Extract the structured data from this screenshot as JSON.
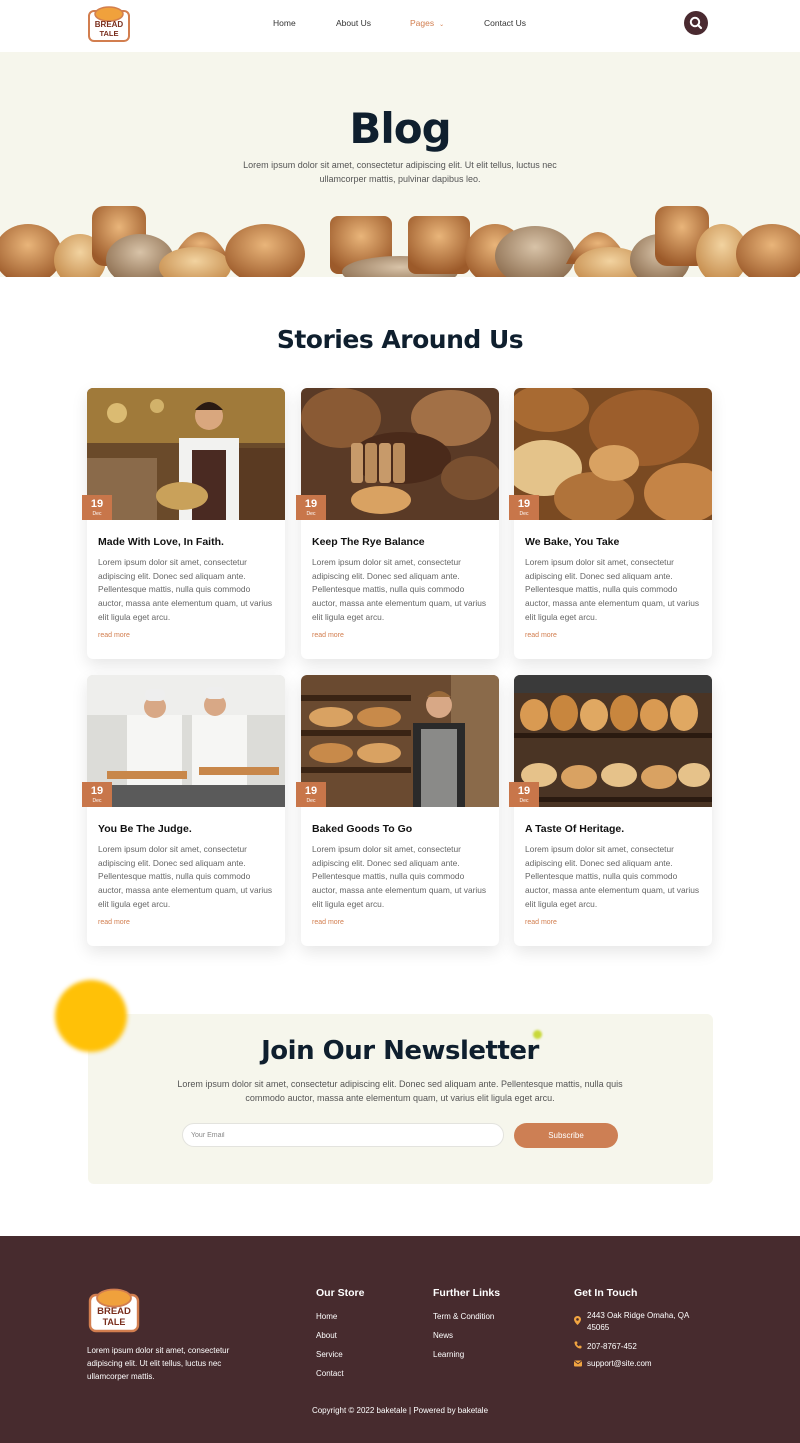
{
  "brand": {
    "logo_line1": "BREAD",
    "logo_line2": "TALE"
  },
  "nav": {
    "items": [
      "Home",
      "About Us",
      "Pages",
      "Contact Us"
    ],
    "pages_caret": "⌄",
    "active_color": "#d27e4f"
  },
  "hero": {
    "title": "Blog",
    "subtitle": "Lorem ipsum dolor sit amet, consectetur adipiscing elit. Ut elit tellus, luctus nec ullamcorper mattis, pulvinar dapibus leo."
  },
  "stories": {
    "title": "Stories Around Us",
    "posts": [
      {
        "title": "Made With Love, In Faith.",
        "day": "19",
        "month": "Dec",
        "text": "Lorem ipsum dolor sit amet, consectetur adipiscing elit. Donec sed aliquam ante. Pellentesque mattis, nulla quis commodo auctor, massa ante elementum quam, ut varius elit ligula eget arcu.",
        "link": "read more",
        "image": "baker-with-bread-basket"
      },
      {
        "title": "Keep The Rye Balance",
        "day": "19",
        "month": "Dec",
        "text": "Lorem ipsum dolor sit amet, consectetur adipiscing elit. Donec sed aliquam ante. Pellentesque mattis, nulla quis commodo auctor, massa ante elementum quam, ut varius elit ligula eget arcu.",
        "link": "read more",
        "image": "sliced-rye-bread"
      },
      {
        "title": "We Bake, You Take",
        "day": "19",
        "month": "Dec",
        "text": "Lorem ipsum dolor sit amet, consectetur adipiscing elit. Donec sed aliquam ante. Pellentesque mattis, nulla quis commodo auctor, massa ante elementum quam, ut varius elit ligula eget arcu.",
        "link": "read more",
        "image": "assorted-bread-loaves"
      },
      {
        "title": "You Be The Judge.",
        "day": "19",
        "month": "Dec",
        "text": "Lorem ipsum dolor sit amet, consectetur adipiscing elit. Donec sed aliquam ante. Pellentesque mattis, nulla quis commodo auctor, massa ante elementum quam, ut varius elit ligula eget arcu.",
        "link": "read more",
        "image": "two-bakers-with-trays"
      },
      {
        "title": "Baked Goods To Go",
        "day": "19",
        "month": "Dec",
        "text": "Lorem ipsum dolor sit amet, consectetur adipiscing elit. Donec sed aliquam ante. Pellentesque mattis, nulla quis commodo auctor, massa ante elementum quam, ut varius elit ligula eget arcu.",
        "link": "read more",
        "image": "baker-at-shelves"
      },
      {
        "title": "A Taste Of Heritage.",
        "day": "19",
        "month": "Dec",
        "text": "Lorem ipsum dolor sit amet, consectetur adipiscing elit. Donec sed aliquam ante. Pellentesque mattis, nulla quis commodo auctor, massa ante elementum quam, ut varius elit ligula eget arcu.",
        "link": "read more",
        "image": "bread-display-shelves"
      }
    ]
  },
  "newsletter": {
    "title": "Join Our Newsletter",
    "text": "Lorem ipsum dolor sit amet, consectetur adipiscing elit. Donec sed aliquam ante. Pellentesque mattis, nulla quis commodo auctor, massa ante elementum quam, ut varius elit ligula eget arcu.",
    "email_placeholder": "Your Email",
    "button": "Subscribe"
  },
  "footer": {
    "about": "Lorem ipsum dolor sit amet, consectetur adipiscing elit. Ut elit tellus, luctus nec ullamcorper mattis.",
    "store": {
      "title": "Our Store",
      "links": [
        "Home",
        "About",
        "Service",
        "Contact"
      ]
    },
    "further": {
      "title": "Further Links",
      "links": [
        "Term & Condition",
        "News",
        "Learning"
      ]
    },
    "contact": {
      "title": "Get In Touch",
      "address": "2443 Oak Ridge Omaha, QA 45065",
      "phone": "207-8767-452",
      "email": "support@site.com"
    },
    "copyright": "Copyright © 2022 baketale | Powered by baketale"
  },
  "colors": {
    "accent": "#cd7f54",
    "dark": "#472b2e",
    "cream": "#f6f6ec",
    "heading": "#0f1f2e"
  },
  "icons": [
    "search-icon",
    "location-icon",
    "phone-icon",
    "email-icon"
  ]
}
